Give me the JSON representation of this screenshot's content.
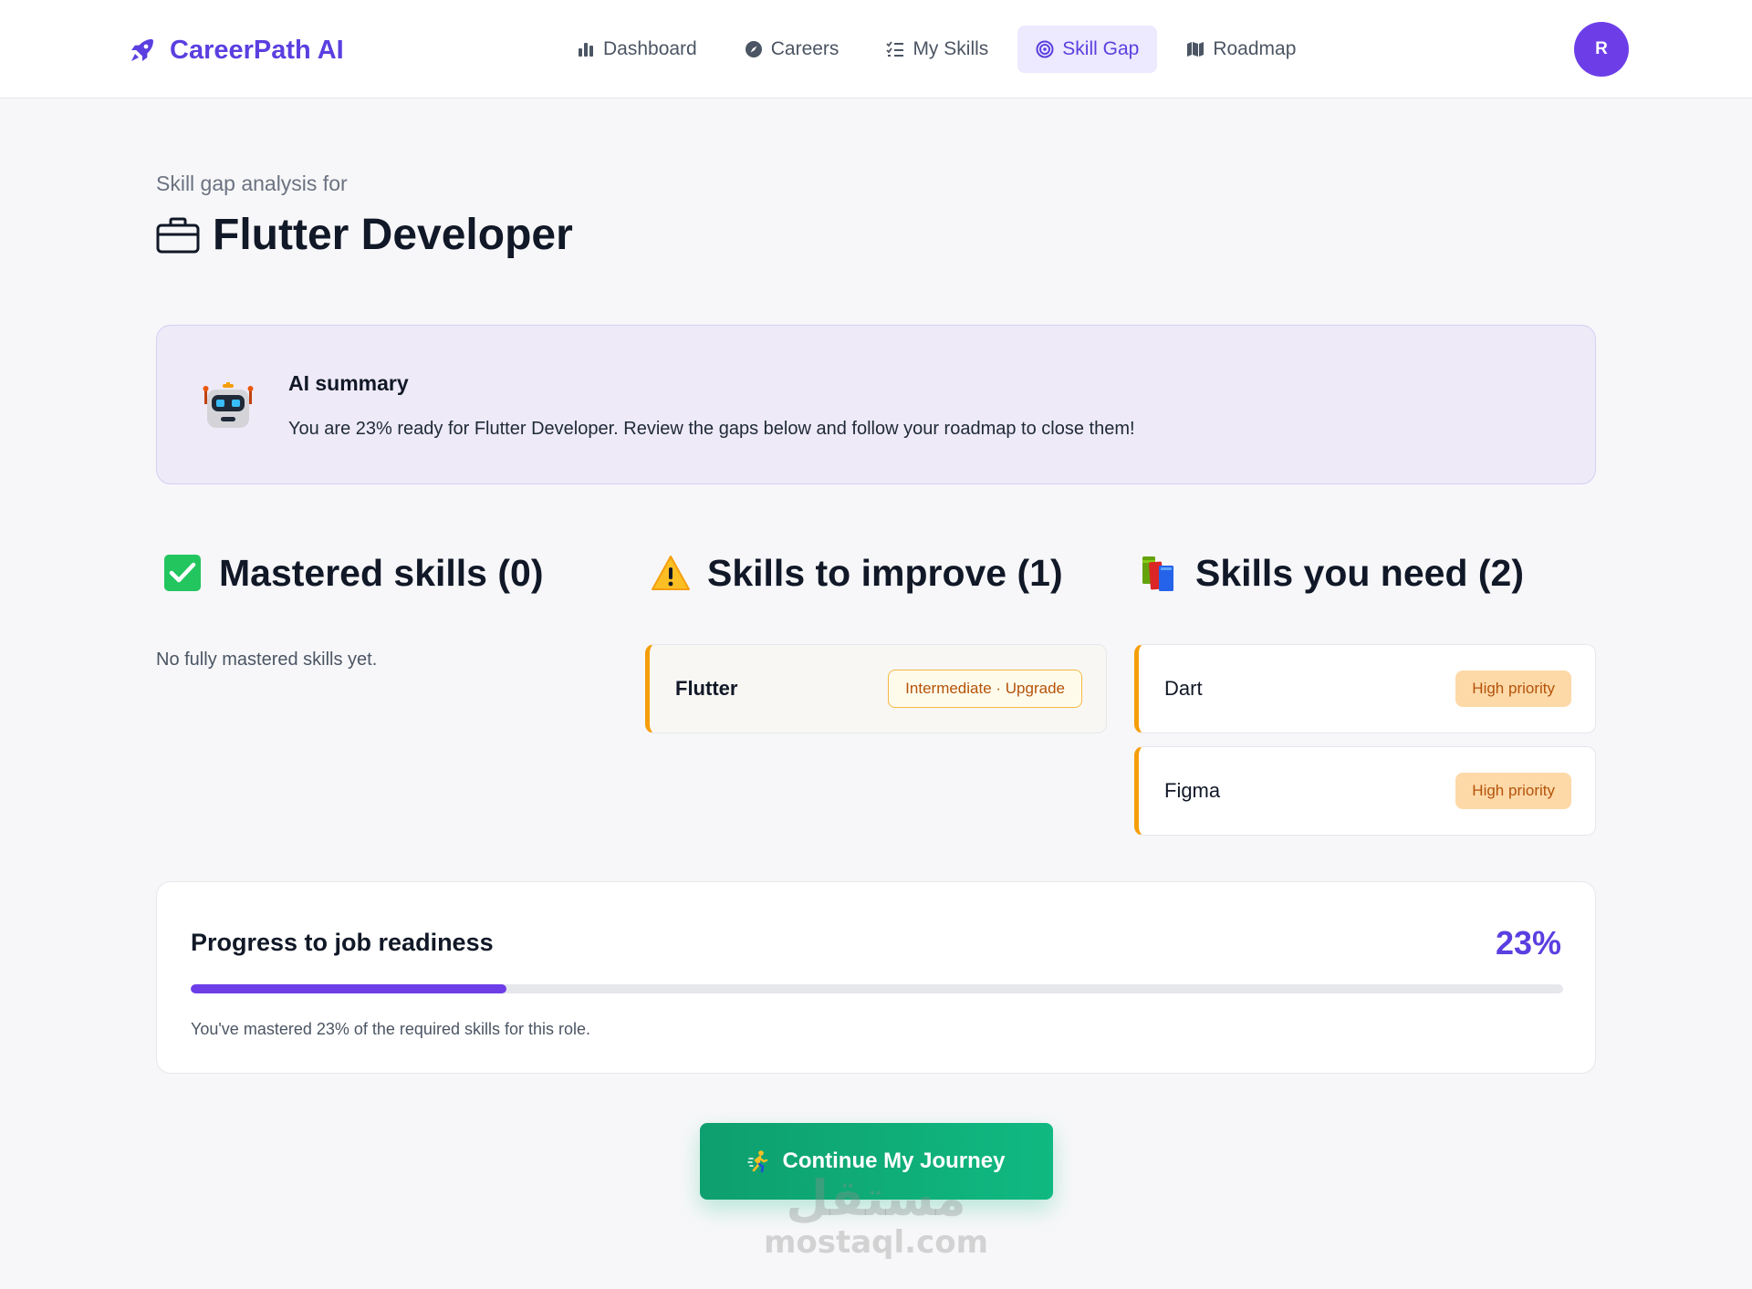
{
  "brand": {
    "name": "CareerPath AI",
    "color": "#5b3fe0"
  },
  "nav": {
    "items": [
      {
        "label": "Dashboard",
        "icon": "bar-chart-icon"
      },
      {
        "label": "Careers",
        "icon": "compass-icon"
      },
      {
        "label": "My Skills",
        "icon": "checklist-icon"
      },
      {
        "label": "Skill Gap",
        "icon": "target-icon",
        "active": true
      },
      {
        "label": "Roadmap",
        "icon": "map-icon"
      }
    ],
    "avatar_initial": "R"
  },
  "header": {
    "subtitle": "Skill gap analysis for",
    "title": "Flutter Developer"
  },
  "ai_summary": {
    "title": "AI summary",
    "text": "You are 23% ready for Flutter Developer. Review the gaps below and follow your roadmap to close them!"
  },
  "columns": {
    "mastered": {
      "title": "Mastered skills (0)",
      "empty_text": "No fully mastered skills yet."
    },
    "improve": {
      "title": "Skills to improve (1)",
      "items": [
        {
          "name": "Flutter",
          "badge": "Intermediate · Upgrade"
        }
      ]
    },
    "need": {
      "title": "Skills you need (2)",
      "items": [
        {
          "name": "Dart",
          "badge": "High priority"
        },
        {
          "name": "Figma",
          "badge": "High priority"
        }
      ]
    }
  },
  "progress": {
    "title": "Progress to job readiness",
    "percent_label": "23%",
    "value": 0.23,
    "caption": "You've mastered 23% of the required skills for this role."
  },
  "cta": {
    "label": "Continue My Journey",
    "icon": "running-person-icon"
  },
  "watermark": {
    "arabic": "مستقل",
    "latin": "mostaql.com"
  },
  "colors": {
    "accent": "#6d3ee8",
    "warning": "#f59e0b",
    "success": "#10b981",
    "ai_card_bg": "#eeeaf8"
  }
}
